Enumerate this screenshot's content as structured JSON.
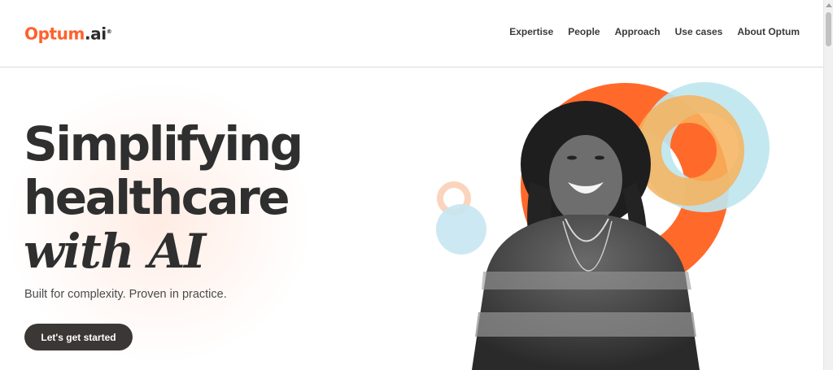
{
  "header": {
    "logo": {
      "brand": "Optum",
      "dot": ".",
      "suffix": "ai",
      "reg": "®"
    },
    "nav": [
      {
        "label": "Expertise"
      },
      {
        "label": "People"
      },
      {
        "label": "Approach"
      },
      {
        "label": "Use cases"
      },
      {
        "label": "About Optum"
      }
    ]
  },
  "hero": {
    "headline_line1": "Simplifying",
    "headline_line2": "healthcare",
    "headline_line3": "with AI",
    "subheadline": "Built for complexity. Proven in practice.",
    "cta_label": "Let's get started"
  },
  "colors": {
    "brand_orange": "#ff612b",
    "light_orange": "#f8ad70",
    "light_blue": "#bfe6ee",
    "dark_button": "#3b3735"
  },
  "icons": [
    "scroll-up-arrow-icon"
  ]
}
